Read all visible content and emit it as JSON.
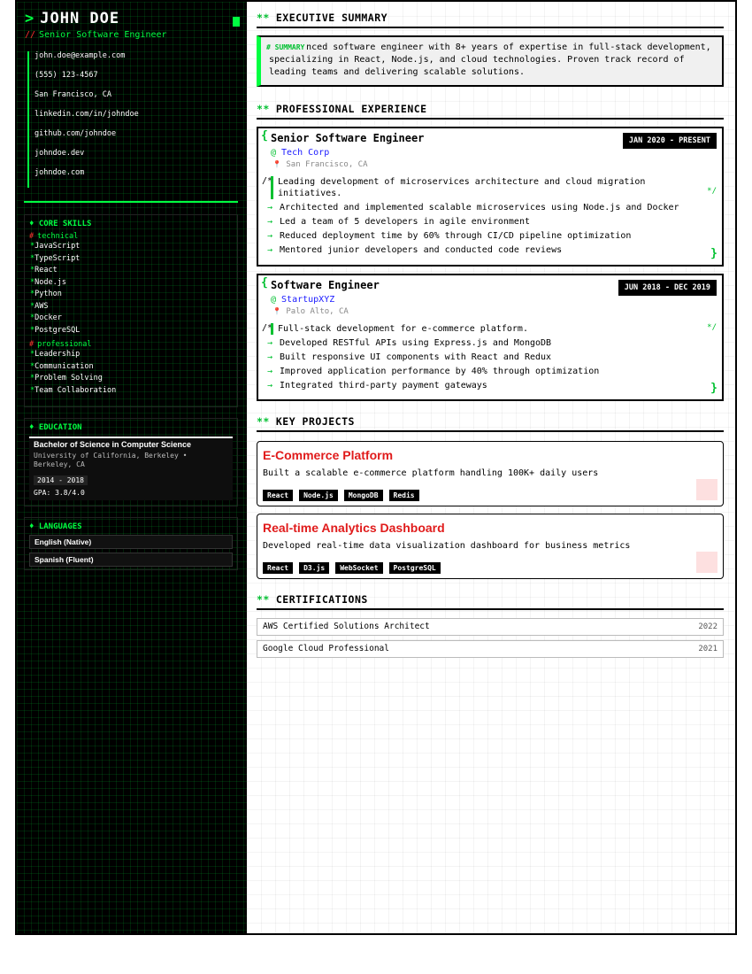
{
  "profile": {
    "prompt": ">",
    "name": "JOHN DOE",
    "role_prefix": "//",
    "role": "Senior Software Engineer"
  },
  "contacts": [
    "john.doe@example.com",
    "(555) 123-4567",
    "San Francisco, CA",
    "linkedin.com/in/johndoe",
    "github.com/johndoe",
    "johndoe.dev",
    "johndoe.com"
  ],
  "skills": {
    "title": "♦ CORE SKILLS",
    "hash": "#",
    "star": "*",
    "technical_label": "technical",
    "technical": [
      "JavaScript",
      "TypeScript",
      "React",
      "Node.js",
      "Python",
      "AWS",
      "Docker",
      "PostgreSQL"
    ],
    "professional_label": "professional",
    "professional": [
      "Leadership",
      "Communication",
      "Problem Solving",
      "Team Collaboration"
    ]
  },
  "education": {
    "title": "♦ EDUCATION",
    "degree": "Bachelor of Science in Computer Science",
    "school": "University of California, Berkeley • Berkeley, CA",
    "years": "2014 - 2018",
    "gpa": "GPA: 3.8/4.0"
  },
  "languages": {
    "title": "♦ LANGUAGES",
    "items": [
      "English (Native)",
      "Spanish (Fluent)"
    ]
  },
  "sections": {
    "marker": "**",
    "summary": "EXECUTIVE SUMMARY",
    "experience": "PROFESSIONAL EXPERIENCE",
    "projects": "KEY PROJECTS",
    "certifications": "CERTIFICATIONS"
  },
  "summary": {
    "tag": "# SUMMARY",
    "text": "Experienced software engineer with 8+ years of expertise in full-stack development, specializing in React, Node.js, and cloud technologies. Proven track record of leading teams and delivering scalable solutions."
  },
  "symbols": {
    "brace_open": "{",
    "brace_close": "}",
    "comment_open": "/*",
    "comment_close": "*/",
    "at": "@",
    "pin": "📍",
    "arrow": "→"
  },
  "experience": [
    {
      "title": "Senior Software Engineer",
      "dates": "JAN 2020 - PRESENT",
      "company": "Tech Corp",
      "location": "San Francisco, CA",
      "description": "Leading development of microservices architecture and cloud migration initiatives.",
      "bullets": [
        "Architected and implemented scalable microservices using Node.js and Docker",
        "Led a team of 5 developers in agile environment",
        "Reduced deployment time by 60% through CI/CD pipeline optimization",
        "Mentored junior developers and conducted code reviews"
      ]
    },
    {
      "title": "Software Engineer",
      "dates": "JUN 2018 - DEC 2019",
      "company": "StartupXYZ",
      "location": "Palo Alto, CA",
      "description": "Full-stack development for e-commerce platform.",
      "bullets": [
        "Developed RESTful APIs using Express.js and MongoDB",
        "Built responsive UI components with React and Redux",
        "Improved application performance by 40% through optimization",
        "Integrated third-party payment gateways"
      ]
    }
  ],
  "projects": [
    {
      "title": "E-Commerce Platform",
      "description": "Built a scalable e-commerce platform handling 100K+ daily users",
      "tags": [
        "React",
        "Node.js",
        "MongoDB",
        "Redis"
      ]
    },
    {
      "title": "Real-time Analytics Dashboard",
      "description": "Developed real-time data visualization dashboard for business metrics",
      "tags": [
        "React",
        "D3.js",
        "WebSocket",
        "PostgreSQL"
      ]
    }
  ],
  "certifications": [
    {
      "name": "AWS Certified Solutions Architect",
      "year": "2022"
    },
    {
      "name": "Google Cloud Professional",
      "year": "2021"
    }
  ],
  "colors": {
    "accent": "#00ff41",
    "accent_dark": "#00c030",
    "danger": "#e01b1b",
    "link": "#1a1aff"
  }
}
